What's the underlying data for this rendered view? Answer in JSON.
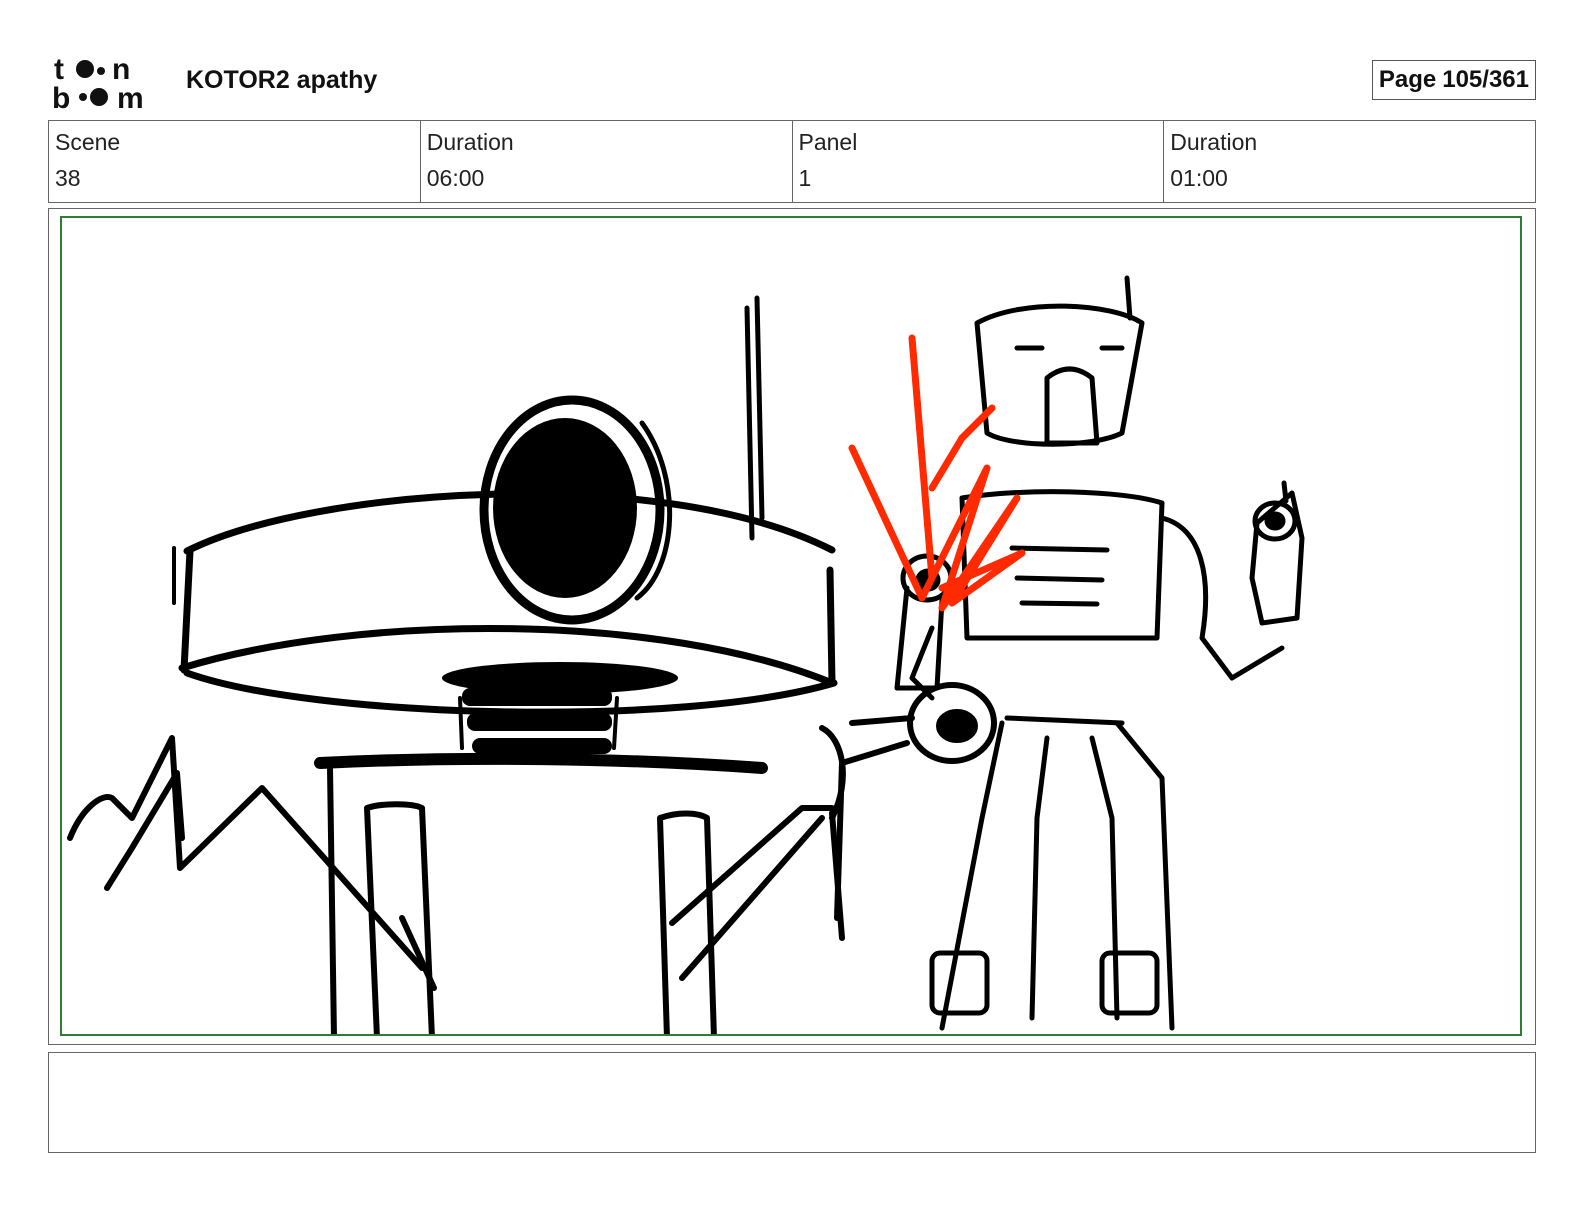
{
  "header": {
    "logo_text": "toon boom",
    "project_title": "KOTOR2 apathy",
    "page_label": "Page",
    "page_number": "105/361"
  },
  "info": {
    "scene_label": "Scene",
    "scene_value": "38",
    "scene_duration_label": "Duration",
    "scene_duration_value": "06:00",
    "panel_label": "Panel",
    "panel_value": "1",
    "panel_duration_label": "Duration",
    "panel_duration_value": "01:00"
  },
  "panel": {
    "frame_color": "#2e7d32",
    "sketch_color": "#000000",
    "blaster_effect_color": "#ff2a00"
  },
  "caption": {
    "text": ""
  }
}
